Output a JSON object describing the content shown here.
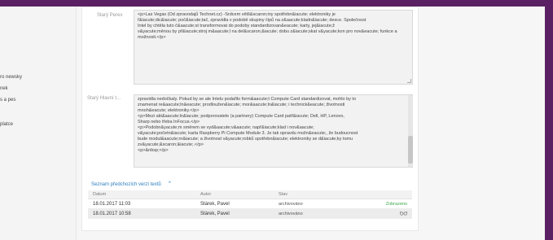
{
  "sidebar": {
    "items": [
      {
        "label": "ro newsky"
      },
      {
        "label": "nek"
      },
      {
        "label": "s a pes"
      },
      {
        "label": "platce"
      }
    ]
  },
  "fields": {
    "old_perex": {
      "label": "Starý Perex",
      "value": "<p>Las Vegas (Od zpravodajů Technet.cz) -Srdcem větš&scaron;iny spotřebn&iacute; elektroniky je\nř&iacute;dic&iacute; poč&iacute;tač, zpravidla v podobě skupiny čipů na z&aacute;kladn&iacute; desce. Společnost\nIntel by chtěla tuto č&aacute;st transformovat do podoby standardizovan&eacute; karty, jej&iacute;ž\nv&yacute;měnou by př&iacute;stroj m&aacute;l na del&scaron;&iacute; dobu z&iacute;skat v&yacute;kon pro nov&eacute; funkce a možnosti.</p>"
    },
    "old_body": {
      "label": "Starý Hlavní t...",
      "value": "zpravidla nedočkaly. Pokud by se ale Intelu podařilo form&aacute;t Compute Card standardizovat, mohlo by to\nznamenat re&aacute;ln&eacute; prodloužen&iacute; mor&aacute;ln&iacute; i technick&eacute; životnosti\nmnoh&eacute; elektroniky.</p>\n<p>Mezi akt&aacute;ln&iacute; podporovatele (a partnery) Compute Card patř&iacute; Dell, HP, Lenovo,\nSharp nebo třeba InFocus.</p>\n<p>Podobn&yacute;m směrem se vyd&aacute;v&aacute; např&iacute;klad i nov&aacute;\nv&yacute;početn&iacute; karta Raspberry Pi Compute Module 3. Je tak opravdu možn&eacute;, že budoucnost\nbude modul&aacute;rn&iacute; a životnost v&yacute;robků spotřebn&iacute; elektroniky se d&iacute;ky tomu\nzv&yacute;&scaron;&iacute;.</p>\n<p>&nbsp;</p>"
    }
  },
  "versions": {
    "toggle_label": "Seznam předchozích verzí textů",
    "columns": [
      "Datum",
      "Autor",
      "Stav"
    ],
    "rows": [
      {
        "date": "18.01.2017 11:03",
        "author": "Stárek, Pavel",
        "status": "archivováno",
        "badge": "Zobrazeno"
      },
      {
        "date": "18.01.2017 10:58",
        "author": "Stárek, Pavel",
        "status": "archivováno",
        "badge": ""
      }
    ]
  },
  "colors": {
    "brand": "#5b2063",
    "link": "#2a7fc1",
    "current": "#3aa84b"
  },
  "icons": {
    "toggle": "chevron-up-icon",
    "compare": "glasses-icon"
  }
}
